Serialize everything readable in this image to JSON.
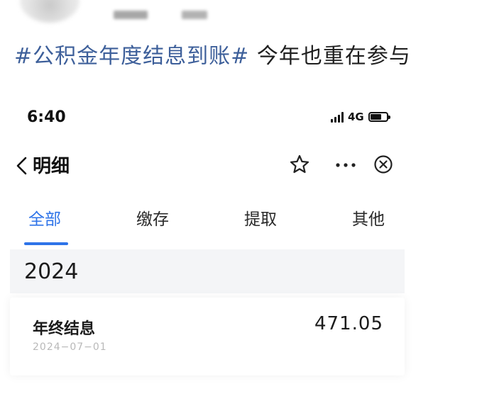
{
  "post": {
    "hashtag": "#公积金年度结息到账#",
    "text": " 今年也重在参与"
  },
  "phone": {
    "status_bar": {
      "time": "6:40",
      "network": "4G",
      "battery_icon": "battery-icon",
      "signal_icon": "signal-icon"
    },
    "navbar": {
      "back_icon": "chevron-left-icon",
      "title": "明细",
      "star_icon": "star-outline-icon",
      "more_icon": "more-dots-icon",
      "close_icon": "close-circle-icon"
    },
    "tabs": [
      {
        "label": "全部",
        "active": true
      },
      {
        "label": "缴存",
        "active": false
      },
      {
        "label": "提取",
        "active": false
      },
      {
        "label": "其他",
        "active": false
      }
    ],
    "year": "2024",
    "records": [
      {
        "title": "年终结息",
        "date": "2024−07−01",
        "amount": "471.05"
      }
    ]
  },
  "colors": {
    "accent": "#2e73e8",
    "hashtag": "#3d5f9a",
    "band": "#f4f5f7"
  }
}
